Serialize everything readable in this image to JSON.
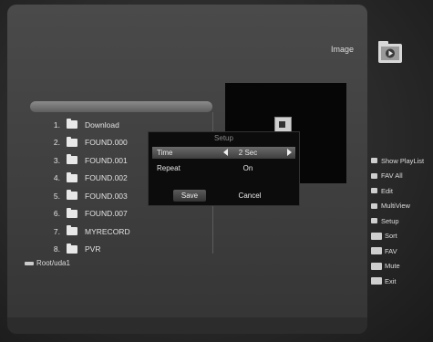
{
  "header": {
    "title": "Image"
  },
  "icons": {
    "header": "image-folder-icon",
    "file": "folder-icon",
    "storage": "usb-icon"
  },
  "file_list": [
    {
      "num": "1.",
      "name": "Download"
    },
    {
      "num": "2.",
      "name": "FOUND.000"
    },
    {
      "num": "3.",
      "name": "FOUND.001"
    },
    {
      "num": "4.",
      "name": "FOUND.002"
    },
    {
      "num": "5.",
      "name": "FOUND.003"
    },
    {
      "num": "6.",
      "name": "FOUND.007"
    },
    {
      "num": "7.",
      "name": "MYRECORD"
    },
    {
      "num": "8.",
      "name": "PVR"
    }
  ],
  "root": {
    "label": "Root/uda1"
  },
  "setup_dialog": {
    "title": "Setup",
    "time_label": "Time",
    "time_value": "2 Sec",
    "repeat_label": "Repeat",
    "repeat_value": "On",
    "save_label": "Save",
    "cancel_label": "Cancel"
  },
  "legend": [
    {
      "key": "",
      "label": "Show PlayList"
    },
    {
      "key": "",
      "label": "FAV All"
    },
    {
      "key": "",
      "label": "Edit"
    },
    {
      "key": "",
      "label": "MultiView"
    },
    {
      "key": "",
      "label": "Setup"
    },
    {
      "key": "",
      "label": "Sort"
    },
    {
      "key": "",
      "label": "FAV"
    },
    {
      "key": "",
      "label": "Mute"
    },
    {
      "key": "",
      "label": "Exit"
    }
  ],
  "colors": {
    "background": "#2a2a2a",
    "panel": "#444444",
    "highlight": "#5e5e5e",
    "dialog": "#0c0c0c"
  }
}
